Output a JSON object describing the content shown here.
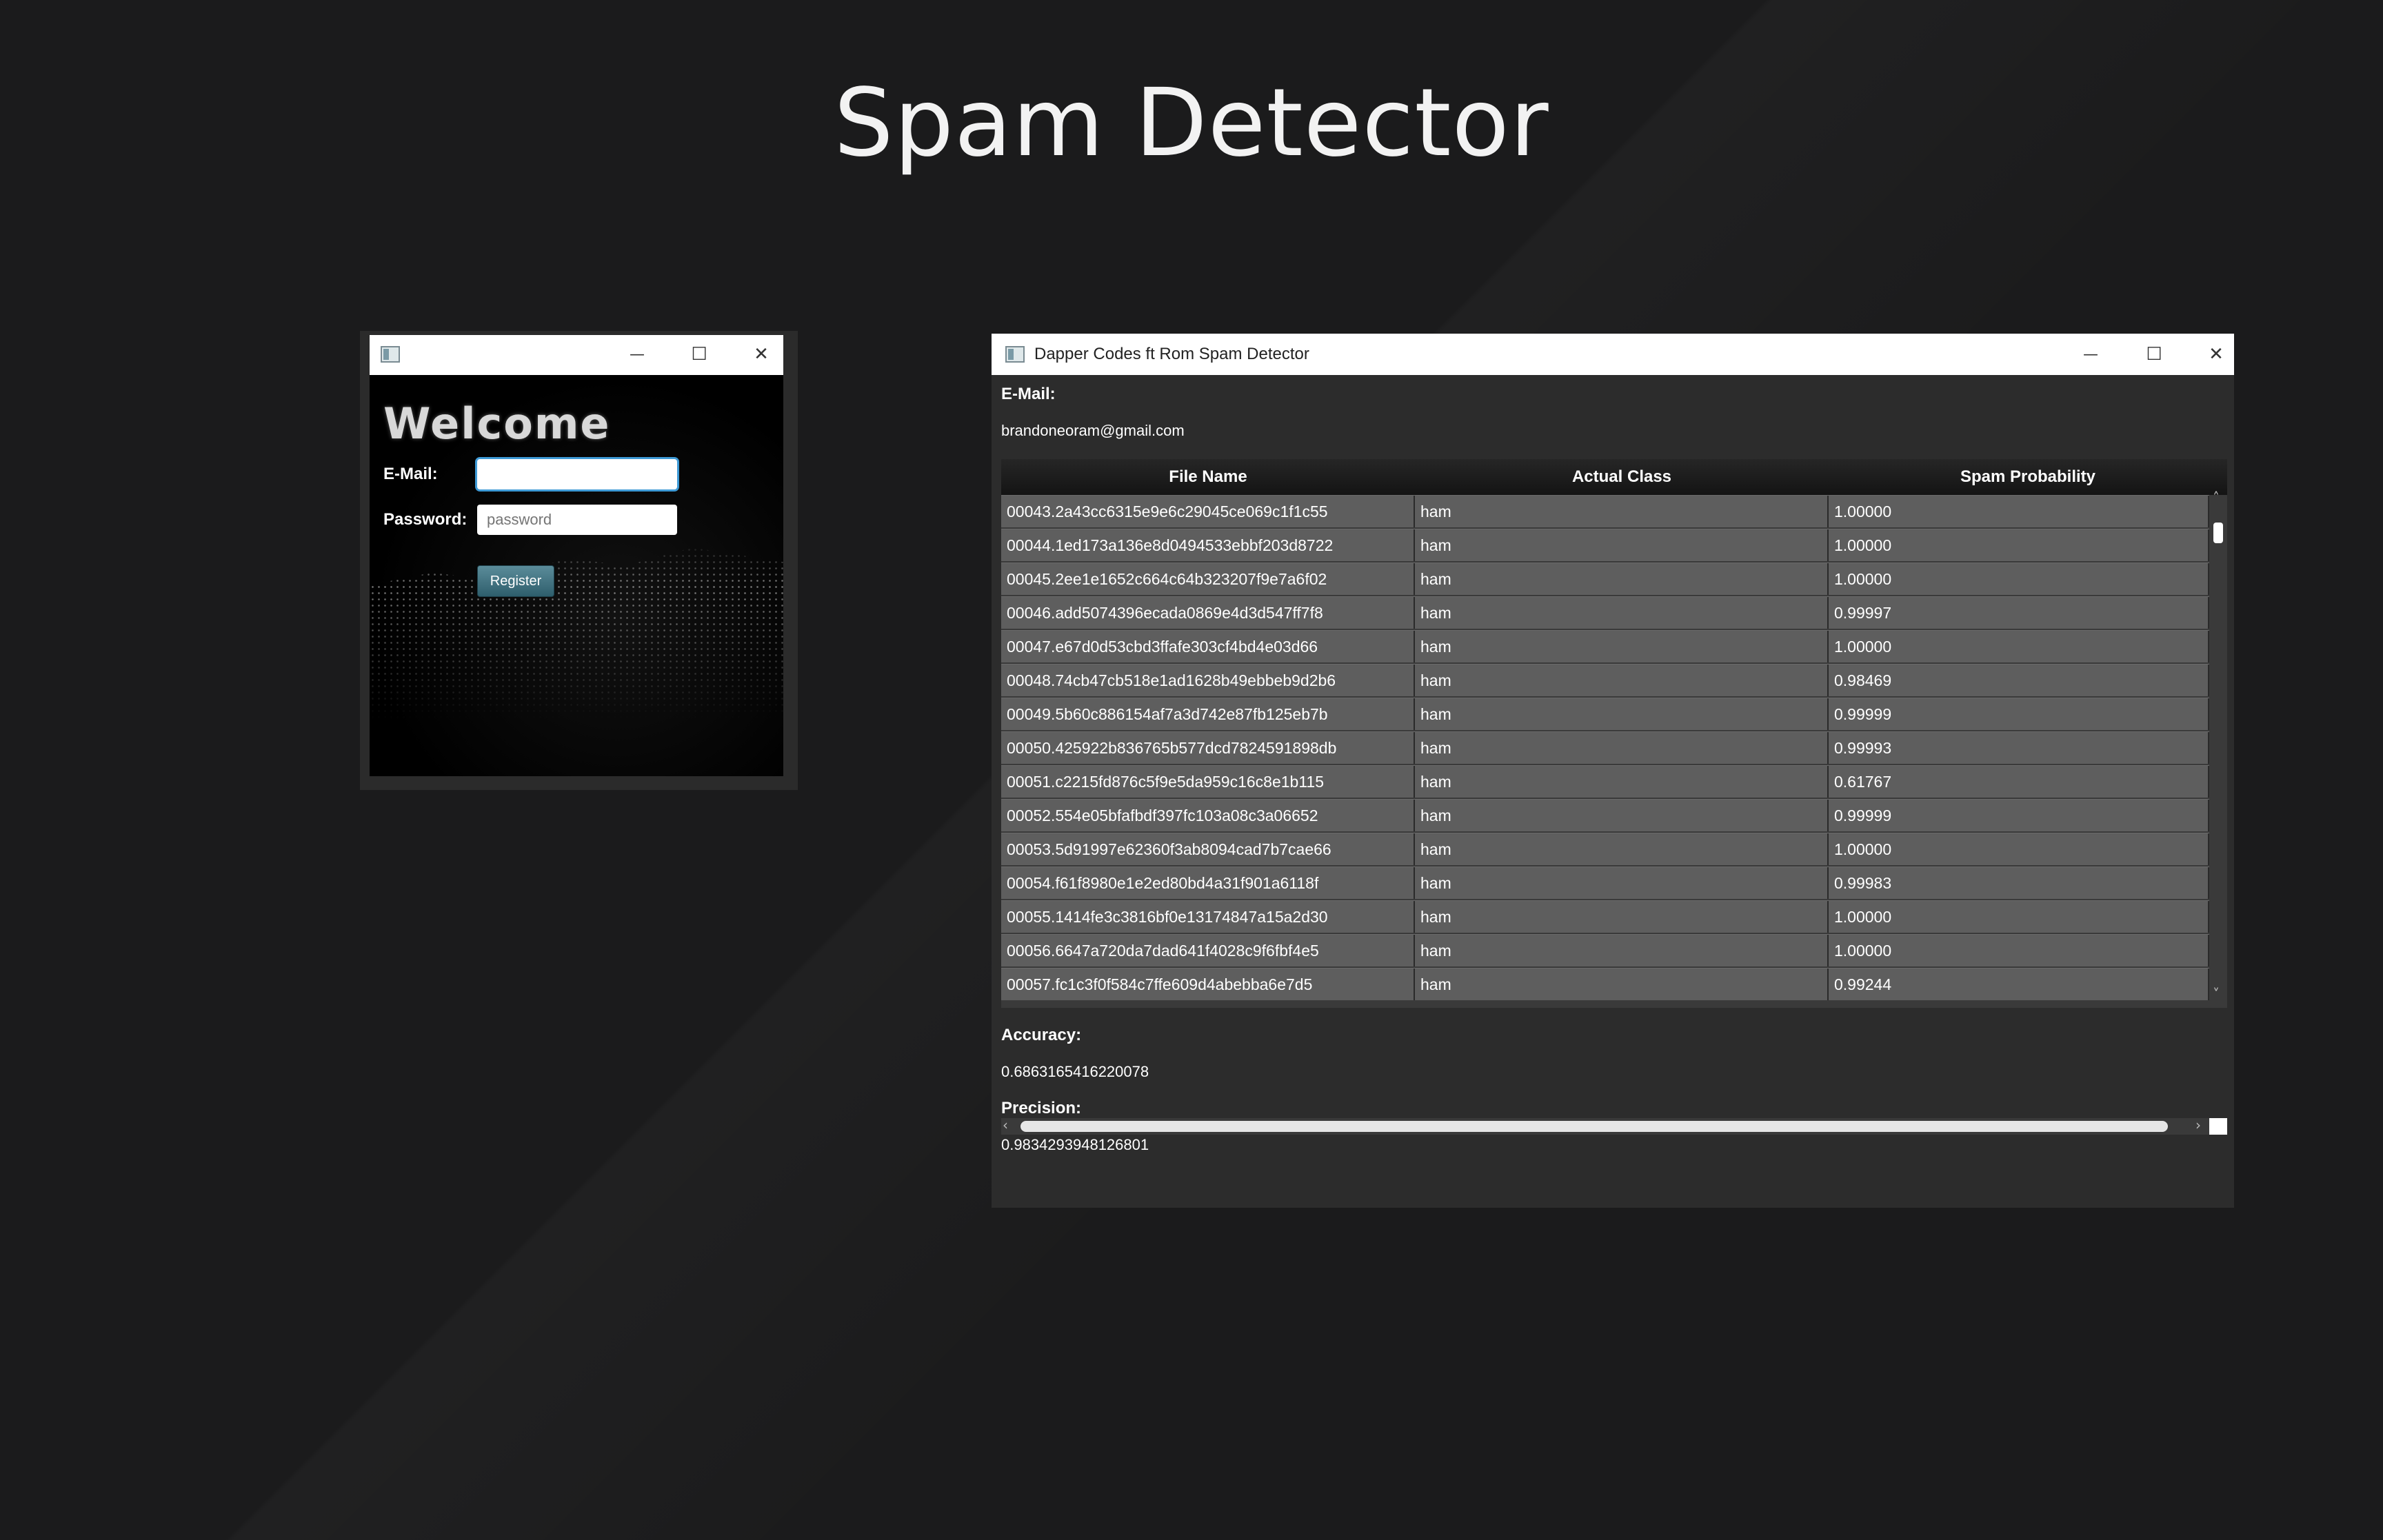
{
  "page": {
    "title": "Spam Detector"
  },
  "login_window": {
    "controls": {
      "minimize": "—",
      "maximize": "☐",
      "close": "✕"
    },
    "heading": "Welcome",
    "email_label": "E-Mail:",
    "email_value": "",
    "password_label": "Password:",
    "password_placeholder": "password",
    "register_label": "Register"
  },
  "spam_window": {
    "title": "Dapper Codes ft Rom Spam Detector",
    "controls": {
      "minimize": "—",
      "maximize": "☐",
      "close": "✕"
    },
    "email_label": "E-Mail:",
    "email_value": "brandoneoram@gmail.com",
    "table": {
      "columns": [
        "File Name",
        "Actual Class",
        "Spam Probability"
      ],
      "rows": [
        [
          "00043.2a43cc6315e9e6c29045ce069c1f1c55",
          "ham",
          "1.00000"
        ],
        [
          "00044.1ed173a136e8d0494533ebbf203d8722",
          "ham",
          "1.00000"
        ],
        [
          "00045.2ee1e1652c664c64b323207f9e7a6f02",
          "ham",
          "1.00000"
        ],
        [
          "00046.add5074396ecada0869e4d3d547ff7f8",
          "ham",
          "0.99997"
        ],
        [
          "00047.e67d0d53cbd3ffafe303cf4bd4e03d66",
          "ham",
          "1.00000"
        ],
        [
          "00048.74cb47cb518e1ad1628b49ebbeb9d2b6",
          "ham",
          "0.98469"
        ],
        [
          "00049.5b60c886154af7a3d742e87fb125eb7b",
          "ham",
          "0.99999"
        ],
        [
          "00050.425922b836765b577dcd7824591898db",
          "ham",
          "0.99993"
        ],
        [
          "00051.c2215fd876c5f9e5da959c16c8e1b115",
          "ham",
          "0.61767"
        ],
        [
          "00052.554e05bfafbdf397fc103a08c3a06652",
          "ham",
          "0.99999"
        ],
        [
          "00053.5d91997e62360f3ab8094cad7b7cae66",
          "ham",
          "1.00000"
        ],
        [
          "00054.f61f8980e1e2ed80bd4a31f901a6118f",
          "ham",
          "0.99983"
        ],
        [
          "00055.1414fe3c3816bf0e13174847a15a2d30",
          "ham",
          "1.00000"
        ],
        [
          "00056.6647a720da7dad641f4028c9f6fbf4e5",
          "ham",
          "1.00000"
        ],
        [
          "00057.fc1c3f0f584c7ffe609d4abebba6e7d5",
          "ham",
          "0.99244"
        ]
      ]
    },
    "accuracy_label": "Accuracy:",
    "accuracy_value": "0.6863165416220078",
    "precision_label": "Precision:",
    "precision_value": "0.9834293948126801"
  }
}
